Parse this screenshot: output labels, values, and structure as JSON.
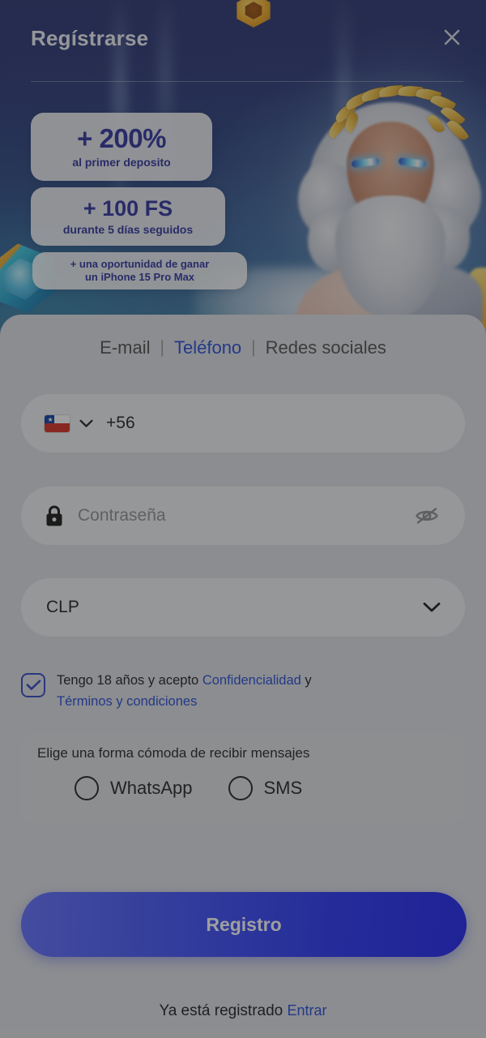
{
  "header": {
    "title": "Regístrarse",
    "close_icon": "close-icon"
  },
  "promo": {
    "badges": [
      {
        "big": "+ 200%",
        "sub": "al primer deposito"
      },
      {
        "big": "+ 100 FS",
        "sub": "durante 5 días seguidos"
      },
      {
        "line1": "+ una oportunidad de ganar",
        "line2": "un iPhone 15 Pro Max"
      }
    ]
  },
  "tabs": {
    "items": [
      {
        "label": "E-mail",
        "active": false
      },
      {
        "label": "Teléfono",
        "active": true
      },
      {
        "label": "Redes sociales",
        "active": false
      }
    ],
    "separator": "|"
  },
  "form": {
    "phone": {
      "flag": "chile-flag-icon",
      "chevron_icon": "chevron-down-icon",
      "country_code": "+56",
      "value": ""
    },
    "password": {
      "lock_icon": "lock-icon",
      "placeholder": "Contraseña",
      "value": "",
      "visibility_icon": "eye-off-icon"
    },
    "currency": {
      "value": "CLP",
      "chevron_icon": "chevron-down-icon"
    },
    "terms": {
      "checked": true,
      "text_before": "Tengo 18 años y acepto ",
      "link_privacy": "Confidencialidad",
      "text_middle": " y",
      "link_terms": "Términos y condiciones"
    },
    "messaging": {
      "title": "Elige una forma cómoda de recibir mensajes",
      "options": [
        {
          "label": "WhatsApp",
          "selected": false
        },
        {
          "label": "SMS",
          "selected": false
        }
      ]
    },
    "submit_label": "Registro"
  },
  "footer": {
    "text": "Ya está registrado",
    "login_link": "Entrar"
  },
  "colors": {
    "accent_blue": "#1f47d8",
    "button_gradient_from": "#5b6bff",
    "button_gradient_to": "#1a1ff0",
    "promo_text": "#2a2f9c",
    "panel_bg": "#dfe1e5",
    "field_bg": "#f1f2f4"
  }
}
